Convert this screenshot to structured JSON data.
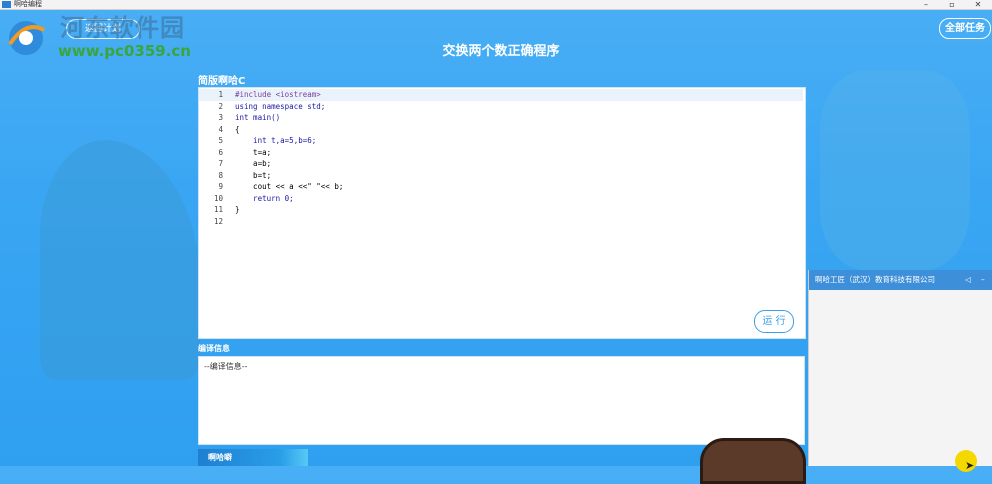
{
  "window": {
    "title": "啊哈编程"
  },
  "header": {
    "back_label": "返回计划",
    "page_title": "交换两个数正确程序",
    "all_tasks_label": "全部任务",
    "watermark_cn": "河东软件园",
    "watermark_url": "www.pc0359.cn"
  },
  "editor": {
    "label": "简版啊哈C",
    "lines": [
      {
        "n": "1",
        "code": "#include <iostream>"
      },
      {
        "n": "2",
        "code": "using namespace std;"
      },
      {
        "n": "3",
        "code": "int main()"
      },
      {
        "n": "4",
        "code": "{"
      },
      {
        "n": "5",
        "code": "    int t,a=5,b=6;"
      },
      {
        "n": "6",
        "code": "    t=a;"
      },
      {
        "n": "7",
        "code": "    a=b;"
      },
      {
        "n": "8",
        "code": "    b=t;"
      },
      {
        "n": "9",
        "code": "    cout << a <<\" \"<< b;"
      },
      {
        "n": "10",
        "code": "    return 0;"
      },
      {
        "n": "11",
        "code": "}"
      },
      {
        "n": "12",
        "code": ""
      }
    ],
    "run_label": "运 行"
  },
  "compile": {
    "label": "编译信息",
    "content": "--编译信息--"
  },
  "bottom_tab": {
    "label": "啊哈噼"
  },
  "side_panel": {
    "title": "啊哈工匠（武汉）教育科技有限公司",
    "speaker_icon": "speaker-icon",
    "minimize_icon": "minus-icon"
  },
  "colors": {
    "accent": "#3b9ee8",
    "background": "#3aa6f3"
  }
}
